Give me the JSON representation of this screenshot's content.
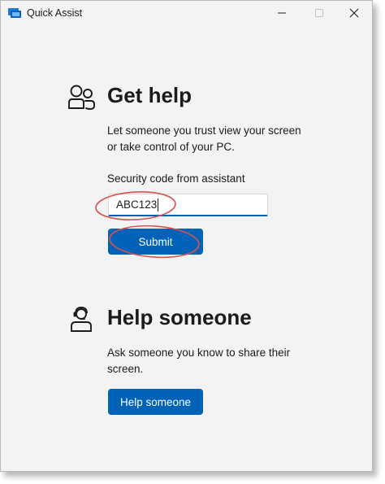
{
  "window": {
    "title": "Quick Assist",
    "icon": "quick-assist-app-icon"
  },
  "controls": {
    "minimize": "minimize-icon",
    "maximize": "maximize-icon",
    "close": "close-icon"
  },
  "get_help": {
    "icon": "people-icon",
    "heading": "Get help",
    "description_line1": "Let someone you trust view your screen",
    "description_line2": "or take control of your PC.",
    "code_label": "Security code from assistant",
    "code_value": "ABC123",
    "submit_label": "Submit"
  },
  "help_someone": {
    "icon": "person-headset-icon",
    "heading": "Help someone",
    "description_line1": "Ask someone you know to share their",
    "description_line2": "screen.",
    "button_label": "Help someone"
  },
  "colors": {
    "accent": "#0063b7",
    "annotation": "#d9534f",
    "window_bg": "#f3f3f3"
  }
}
